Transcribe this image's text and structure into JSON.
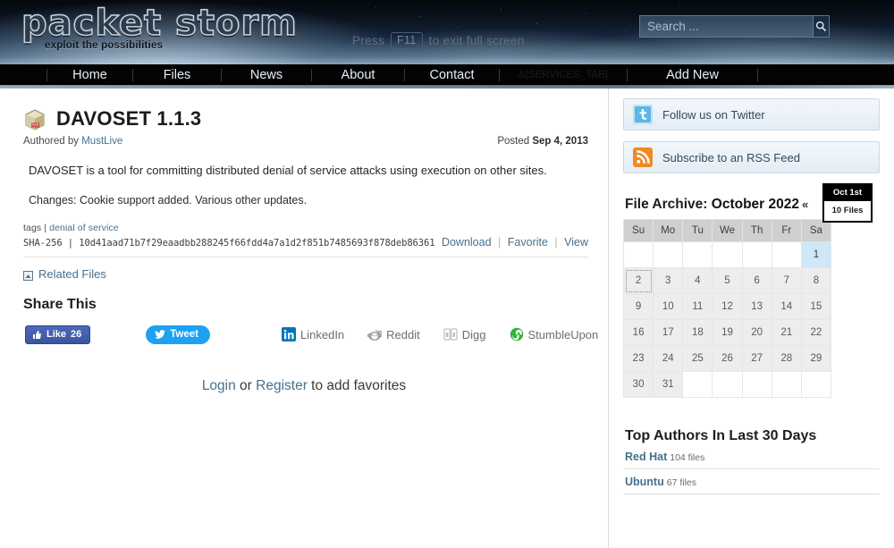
{
  "header": {
    "logo_text": "packet storm",
    "logo_tagline": "exploit the possibilities",
    "fullscreen_prefix": "Press",
    "fullscreen_key": "F11",
    "fullscreen_suffix": "to exit full screen",
    "search_placeholder": "Search ...",
    "search_value": "",
    "search_icon": "magnifier-icon"
  },
  "nav": {
    "items": [
      {
        "label": "Home",
        "active": false
      },
      {
        "label": "Files",
        "active": true
      },
      {
        "label": "News",
        "active": false
      },
      {
        "label": "About",
        "active": false
      },
      {
        "label": "Contact",
        "active": false
      },
      {
        "label": "&[SERVICES_TAB]",
        "active": false
      },
      {
        "label": "Add New",
        "active": false
      }
    ]
  },
  "main": {
    "file_icon": "archive-package-icon",
    "title": "DAVOSET 1.1.3",
    "authored_prefix": "Authored by",
    "author": "MustLive",
    "posted_prefix": "Posted",
    "posted_date": "Sep 4, 2013",
    "description": "DAVOSET is a tool for committing distributed denial of service attacks using execution on other sites.",
    "changes": "Changes: Cookie support added. Various other updates.",
    "tags_label": "tags",
    "tags_sep": "|",
    "tag": "denial of service",
    "sha_label": "SHA-256",
    "sha_sep": "|",
    "sha_value": "10d41aad71b7f29eaadbb288245f66fdd4a7a1d2f851b7485693f878deb86361",
    "action_download": "Download",
    "action_favorite": "Favorite",
    "action_view": "View",
    "related_icon": "related-files-icon",
    "related_files": "Related Files",
    "share_heading": "Share This",
    "facebook_label": "Like",
    "facebook_count": "26",
    "facebook_icon": "thumbs-up-icon",
    "twitter_label": "Tweet",
    "twitter_icon": "twitter-bird-icon",
    "services": [
      {
        "label": "LinkedIn",
        "icon": "linkedin-icon"
      },
      {
        "label": "Reddit",
        "icon": "reddit-icon"
      },
      {
        "label": "Digg",
        "icon": "digg-icon"
      },
      {
        "label": "StumbleUpon",
        "icon": "stumbleupon-icon"
      }
    ],
    "login_link": "Login",
    "login_or": " or ",
    "register_link": "Register",
    "login_suffix": " to add favorites"
  },
  "sidebar": {
    "twitter_widget": {
      "label": "Follow us on Twitter",
      "icon": "twitter-icon"
    },
    "rss_widget": {
      "label": "Subscribe to an RSS Feed",
      "icon": "rss-icon"
    },
    "archive": {
      "heading_label": "File Archive:",
      "month": "October 2022",
      "prev_arrow": "«",
      "weekdays": [
        "Su",
        "Mo",
        "Tu",
        "We",
        "Th",
        "Fr",
        "Sa"
      ],
      "weeks": [
        [
          "",
          "",
          "",
          "",
          "",
          "",
          "1"
        ],
        [
          "2",
          "3",
          "4",
          "5",
          "6",
          "7",
          "8"
        ],
        [
          "9",
          "10",
          "11",
          "12",
          "13",
          "14",
          "15"
        ],
        [
          "16",
          "17",
          "18",
          "19",
          "20",
          "21",
          "22"
        ],
        [
          "23",
          "24",
          "25",
          "26",
          "27",
          "28",
          "29"
        ],
        [
          "30",
          "31",
          "",
          "",
          "",
          "",
          ""
        ]
      ],
      "selected_day": "1",
      "focused_day": "2",
      "tooltip_title": "Oct 1st",
      "tooltip_body": "10 Files"
    },
    "top_authors": {
      "heading": "Top Authors In Last 30 Days",
      "rows": [
        {
          "name": "Red Hat",
          "count": "104 files"
        },
        {
          "name": "Ubuntu",
          "count": "67 files"
        }
      ]
    }
  },
  "colors": {
    "link": "#46708f",
    "nav_bg": "#000000",
    "facebook": "#4c69ba",
    "twitter": "#1da1f2",
    "rss": "#f08a24",
    "selected_day": "#cfe7f7"
  }
}
